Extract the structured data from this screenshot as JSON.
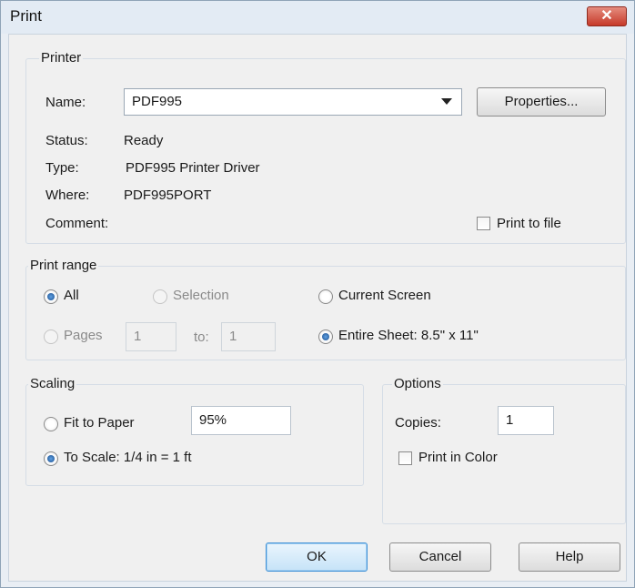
{
  "window": {
    "title": "Print",
    "close_label": "✕"
  },
  "printer": {
    "legend": "Printer",
    "name_label": "Name:",
    "name_value": "PDF995",
    "properties_button": "Properties...",
    "status_label": "Status:",
    "status_value": "Ready",
    "type_label": "Type:",
    "type_value": "PDF995 Printer Driver",
    "where_label": "Where:",
    "where_value": "PDF995PORT",
    "comment_label": "Comment:",
    "print_to_file_label": "Print to file",
    "print_to_file_checked": false
  },
  "print_range": {
    "legend": "Print range",
    "all_label": "All",
    "selection_label": "Selection",
    "current_screen_label": "Current Screen",
    "pages_label": "Pages",
    "pages_from": "1",
    "to_label": "to:",
    "pages_to": "1",
    "entire_sheet_label": "Entire Sheet: 8.5\" x 11\""
  },
  "scaling": {
    "legend": "Scaling",
    "fit_to_paper_label": "Fit to Paper",
    "fit_percent": "95%",
    "to_scale_label": "To Scale: 1/4 in = 1 ft"
  },
  "options": {
    "legend": "Options",
    "copies_label": "Copies:",
    "copies_value": "1",
    "print_in_color_label": "Print in Color",
    "print_in_color_checked": false
  },
  "buttons": {
    "ok": "OK",
    "cancel": "Cancel",
    "help": "Help"
  }
}
